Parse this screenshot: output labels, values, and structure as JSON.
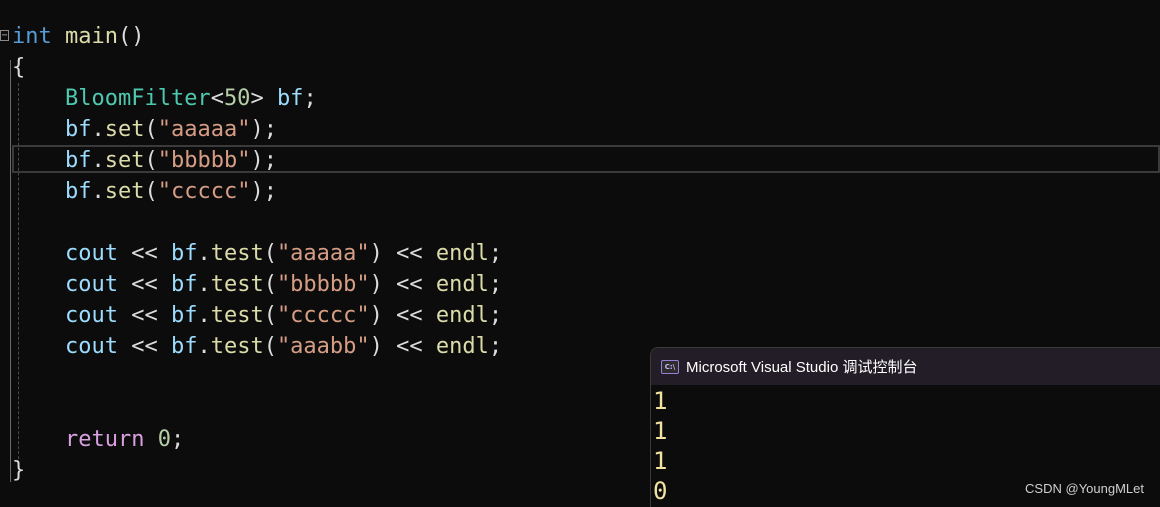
{
  "editor": {
    "lines": [
      {
        "tokens": [
          {
            "t": "int",
            "c": "kw"
          },
          {
            "t": " ",
            "c": "punc"
          },
          {
            "t": "main",
            "c": "fn"
          },
          {
            "t": "()",
            "c": "punc"
          }
        ]
      },
      {
        "tokens": [
          {
            "t": "{",
            "c": "punc"
          }
        ]
      },
      {
        "tokens": [
          {
            "t": "    ",
            "c": "punc"
          },
          {
            "t": "BloomFilter",
            "c": "type"
          },
          {
            "t": "<",
            "c": "punc"
          },
          {
            "t": "50",
            "c": "num"
          },
          {
            "t": "> ",
            "c": "punc"
          },
          {
            "t": "bf",
            "c": "var"
          },
          {
            "t": ";",
            "c": "punc"
          }
        ]
      },
      {
        "tokens": [
          {
            "t": "    ",
            "c": "punc"
          },
          {
            "t": "bf",
            "c": "var"
          },
          {
            "t": ".",
            "c": "punc"
          },
          {
            "t": "set",
            "c": "fn"
          },
          {
            "t": "(",
            "c": "punc"
          },
          {
            "t": "\"aaaaa\"",
            "c": "str"
          },
          {
            "t": ");",
            "c": "punc"
          }
        ]
      },
      {
        "tokens": [
          {
            "t": "    ",
            "c": "punc"
          },
          {
            "t": "bf",
            "c": "var"
          },
          {
            "t": ".",
            "c": "punc"
          },
          {
            "t": "set",
            "c": "fn"
          },
          {
            "t": "(",
            "c": "punc"
          },
          {
            "t": "\"bbbbb\"",
            "c": "str"
          },
          {
            "t": ");",
            "c": "punc"
          }
        ]
      },
      {
        "tokens": [
          {
            "t": "    ",
            "c": "punc"
          },
          {
            "t": "bf",
            "c": "var"
          },
          {
            "t": ".",
            "c": "punc"
          },
          {
            "t": "set",
            "c": "fn"
          },
          {
            "t": "(",
            "c": "punc"
          },
          {
            "t": "\"ccccc\"",
            "c": "str"
          },
          {
            "t": ");",
            "c": "punc"
          }
        ]
      },
      {
        "tokens": []
      },
      {
        "tokens": [
          {
            "t": "    ",
            "c": "punc"
          },
          {
            "t": "cout",
            "c": "var"
          },
          {
            "t": " << ",
            "c": "punc"
          },
          {
            "t": "bf",
            "c": "var"
          },
          {
            "t": ".",
            "c": "punc"
          },
          {
            "t": "test",
            "c": "fn"
          },
          {
            "t": "(",
            "c": "punc"
          },
          {
            "t": "\"aaaaa\"",
            "c": "str"
          },
          {
            "t": ") << ",
            "c": "punc"
          },
          {
            "t": "endl",
            "c": "fn"
          },
          {
            "t": ";",
            "c": "punc"
          }
        ]
      },
      {
        "tokens": [
          {
            "t": "    ",
            "c": "punc"
          },
          {
            "t": "cout",
            "c": "var"
          },
          {
            "t": " << ",
            "c": "punc"
          },
          {
            "t": "bf",
            "c": "var"
          },
          {
            "t": ".",
            "c": "punc"
          },
          {
            "t": "test",
            "c": "fn"
          },
          {
            "t": "(",
            "c": "punc"
          },
          {
            "t": "\"bbbbb\"",
            "c": "str"
          },
          {
            "t": ") << ",
            "c": "punc"
          },
          {
            "t": "endl",
            "c": "fn"
          },
          {
            "t": ";",
            "c": "punc"
          }
        ]
      },
      {
        "tokens": [
          {
            "t": "    ",
            "c": "punc"
          },
          {
            "t": "cout",
            "c": "var"
          },
          {
            "t": " << ",
            "c": "punc"
          },
          {
            "t": "bf",
            "c": "var"
          },
          {
            "t": ".",
            "c": "punc"
          },
          {
            "t": "test",
            "c": "fn"
          },
          {
            "t": "(",
            "c": "punc"
          },
          {
            "t": "\"ccccc\"",
            "c": "str"
          },
          {
            "t": ") << ",
            "c": "punc"
          },
          {
            "t": "endl",
            "c": "fn"
          },
          {
            "t": ";",
            "c": "punc"
          }
        ]
      },
      {
        "tokens": [
          {
            "t": "    ",
            "c": "punc"
          },
          {
            "t": "cout",
            "c": "var"
          },
          {
            "t": " << ",
            "c": "punc"
          },
          {
            "t": "bf",
            "c": "var"
          },
          {
            "t": ".",
            "c": "punc"
          },
          {
            "t": "test",
            "c": "fn"
          },
          {
            "t": "(",
            "c": "punc"
          },
          {
            "t": "\"aaabb\"",
            "c": "str"
          },
          {
            "t": ") << ",
            "c": "punc"
          },
          {
            "t": "endl",
            "c": "fn"
          },
          {
            "t": ";",
            "c": "punc"
          }
        ]
      },
      {
        "tokens": []
      },
      {
        "tokens": []
      },
      {
        "tokens": [
          {
            "t": "    ",
            "c": "punc"
          },
          {
            "t": "return",
            "c": "ctrl"
          },
          {
            "t": " ",
            "c": "punc"
          },
          {
            "t": "0",
            "c": "num"
          },
          {
            "t": ";",
            "c": "punc"
          }
        ]
      },
      {
        "tokens": [
          {
            "t": "}",
            "c": "punc"
          }
        ]
      }
    ]
  },
  "console": {
    "title": "Microsoft Visual Studio 调试控制台",
    "icon": "console-app-icon",
    "icon_glyph": "C:\\",
    "output": [
      "1",
      "1",
      "1",
      "0"
    ]
  },
  "watermark": "CSDN @YoungMLet",
  "colors": {
    "keyword": "#569cd6",
    "control": "#d8a0df",
    "function": "#dcdcaa",
    "type": "#4ec9b0",
    "number": "#b5cea8",
    "variable": "#9cdcfe",
    "string": "#d69d85",
    "console_output": "#f2e3a0"
  }
}
